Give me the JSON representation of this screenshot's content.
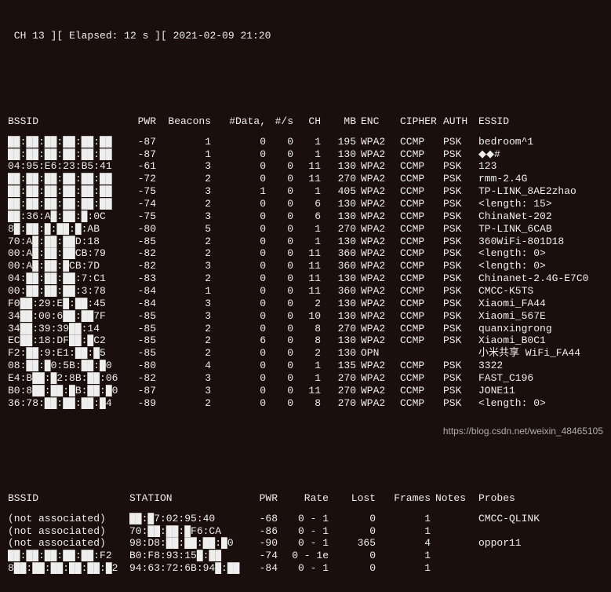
{
  "top_line": " CH 13 ][ Elapsed: 12 s ][ 2021-02-09 21:20",
  "ap_headers": {
    "bssid": "BSSID",
    "pwr": "PWR",
    "beacons": "Beacons",
    "data": "#Data,",
    "ps": "#/s",
    "ch": "CH",
    "mb": "MB",
    "enc": "ENC",
    "cipher": "CIPHER",
    "auth": "AUTH",
    "essid": "ESSID"
  },
  "aps": [
    {
      "bssid": "██:██:██:██:██:██",
      "pwr": "-87",
      "beacons": "1",
      "data": "0",
      "ps": "0",
      "ch": "1",
      "mb": "195",
      "enc": "WPA2",
      "cipher": "CCMP",
      "auth": "PSK",
      "essid": "bedroom^1"
    },
    {
      "bssid": "██:██:██:██:██:██",
      "pwr": "-87",
      "beacons": "1",
      "data": "0",
      "ps": "0",
      "ch": "1",
      "mb": "130",
      "enc": "WPA2",
      "cipher": "CCMP",
      "auth": "PSK",
      "essid": "◆◆#"
    },
    {
      "bssid": "04:95:E6:23:B5:41",
      "pwr": "-61",
      "beacons": "3",
      "data": "0",
      "ps": "0",
      "ch": "11",
      "mb": "130",
      "enc": "WPA2",
      "cipher": "CCMP",
      "auth": "PSK",
      "essid": "123"
    },
    {
      "bssid": "██:██:██:██:██:██",
      "pwr": "-72",
      "beacons": "2",
      "data": "0",
      "ps": "0",
      "ch": "11",
      "mb": "270",
      "enc": "WPA2",
      "cipher": "CCMP",
      "auth": "PSK",
      "essid": "rmm-2.4G"
    },
    {
      "bssid": "██:██:██:██:██:██",
      "pwr": "-75",
      "beacons": "3",
      "data": "1",
      "ps": "0",
      "ch": "1",
      "mb": "405",
      "enc": "WPA2",
      "cipher": "CCMP",
      "auth": "PSK",
      "essid": "TP-LINK_8AE2zhao"
    },
    {
      "bssid": "██:██:██:██:██:██",
      "pwr": "-74",
      "beacons": "2",
      "data": "0",
      "ps": "0",
      "ch": "6",
      "mb": "130",
      "enc": "WPA2",
      "cipher": "CCMP",
      "auth": "PSK",
      "essid": "<length: 15>"
    },
    {
      "bssid": "██:36:A█:██:█:0C",
      "pwr": "-75",
      "beacons": "3",
      "data": "0",
      "ps": "0",
      "ch": "6",
      "mb": "130",
      "enc": "WPA2",
      "cipher": "CCMP",
      "auth": "PSK",
      "essid": "ChinaNet-202"
    },
    {
      "bssid": "8█:██:█:██:█:AB",
      "pwr": "-80",
      "beacons": "5",
      "data": "0",
      "ps": "0",
      "ch": "1",
      "mb": "270",
      "enc": "WPA2",
      "cipher": "CCMP",
      "auth": "PSK",
      "essid": "TP-LINK_6CAB"
    },
    {
      "bssid": "70:A█:██:██D:18",
      "pwr": "-85",
      "beacons": "2",
      "data": "0",
      "ps": "0",
      "ch": "1",
      "mb": "130",
      "enc": "WPA2",
      "cipher": "CCMP",
      "auth": "PSK",
      "essid": "360WiFi-801D18"
    },
    {
      "bssid": "00:A█:██:██CB:79",
      "pwr": "-82",
      "beacons": "2",
      "data": "0",
      "ps": "0",
      "ch": "11",
      "mb": "360",
      "enc": "WPA2",
      "cipher": "CCMP",
      "auth": "PSK",
      "essid": "<length:  0>"
    },
    {
      "bssid": "00:A█:██:█CB:7D",
      "pwr": "-82",
      "beacons": "3",
      "data": "0",
      "ps": "0",
      "ch": "11",
      "mb": "360",
      "enc": "WPA2",
      "cipher": "CCMP",
      "auth": "PSK",
      "essid": "<length:  0>"
    },
    {
      "bssid": "04:██:██:██:7:C1",
      "pwr": "-83",
      "beacons": "2",
      "data": "0",
      "ps": "0",
      "ch": "11",
      "mb": "130",
      "enc": "WPA2",
      "cipher": "CCMP",
      "auth": "PSK",
      "essid": "Chinanet-2.4G-E7C0"
    },
    {
      "bssid": "00:██:██:██:3:78",
      "pwr": "-84",
      "beacons": "1",
      "data": "0",
      "ps": "0",
      "ch": "11",
      "mb": "360",
      "enc": "WPA2",
      "cipher": "CCMP",
      "auth": "PSK",
      "essid": "CMCC-K5TS"
    },
    {
      "bssid": "F0██:29:E█:██:45",
      "pwr": "-84",
      "beacons": "3",
      "data": "0",
      "ps": "0",
      "ch": "2",
      "mb": "130",
      "enc": "WPA2",
      "cipher": "CCMP",
      "auth": "PSK",
      "essid": "Xiaomi_FA44"
    },
    {
      "bssid": "34██:00:6██:██7F",
      "pwr": "-85",
      "beacons": "3",
      "data": "0",
      "ps": "0",
      "ch": "10",
      "mb": "130",
      "enc": "WPA2",
      "cipher": "CCMP",
      "auth": "PSK",
      "essid": "Xiaomi_567E"
    },
    {
      "bssid": "34██:39:39██:14",
      "pwr": "-85",
      "beacons": "2",
      "data": "0",
      "ps": "0",
      "ch": "8",
      "mb": "270",
      "enc": "WPA2",
      "cipher": "CCMP",
      "auth": "PSK",
      "essid": "quanxingrong"
    },
    {
      "bssid": "EC██:18:DF██:█C2",
      "pwr": "-85",
      "beacons": "2",
      "data": "6",
      "ps": "0",
      "ch": "8",
      "mb": "130",
      "enc": "WPA2",
      "cipher": "CCMP",
      "auth": "PSK",
      "essid": "Xiaomi_B0C1"
    },
    {
      "bssid": "F2:██:9:E1:██:█5",
      "pwr": "-85",
      "beacons": "2",
      "data": "0",
      "ps": "0",
      "ch": "2",
      "mb": "130",
      "enc": "OPN",
      "cipher": "",
      "auth": "",
      "essid": "      小米共享 WiFi_FA44"
    },
    {
      "bssid": "08:██:█0:5B:██:█0",
      "pwr": "-80",
      "beacons": "4",
      "data": "0",
      "ps": "0",
      "ch": "1",
      "mb": "135",
      "enc": "WPA2",
      "cipher": "CCMP",
      "auth": "PSK",
      "essid": "3322"
    },
    {
      "bssid": "E4:B██:█2:8B:██:06",
      "pwr": "-82",
      "beacons": "3",
      "data": "0",
      "ps": "0",
      "ch": "1",
      "mb": "270",
      "enc": "WPA2",
      "cipher": "CCMP",
      "auth": "PSK",
      "essid": "FAST_C196"
    },
    {
      "bssid": "B0:8██:██:█B:██:█0",
      "pwr": "-87",
      "beacons": "3",
      "data": "0",
      "ps": "0",
      "ch": "11",
      "mb": "270",
      "enc": "WPA2",
      "cipher": "CCMP",
      "auth": "PSK",
      "essid": "JONE11"
    },
    {
      "bssid": "36:78:██:██:██:█4",
      "pwr": "-89",
      "beacons": "2",
      "data": "0",
      "ps": "0",
      "ch": "8",
      "mb": "270",
      "enc": "WPA2",
      "cipher": "CCMP",
      "auth": "PSK",
      "essid": "<length:  0>"
    }
  ],
  "sta_headers": {
    "bssid": "BSSID",
    "station": "STATION",
    "pwr": "PWR",
    "rate": "Rate",
    "lost": "Lost",
    "frames": "Frames",
    "notes": "Notes",
    "probes": "Probes"
  },
  "stations": [
    {
      "bssid": "(not associated)",
      "station": "██:█7:02:95:40",
      "pwr": "-68",
      "rate": "0 - 1",
      "lost": "0",
      "frames": "1",
      "notes": "",
      "probes": "CMCC-QLINK"
    },
    {
      "bssid": "(not associated)",
      "station": "70:██:██:█F6:CA",
      "pwr": "-86",
      "rate": "0 - 1",
      "lost": "0",
      "frames": "1",
      "notes": "",
      "probes": ""
    },
    {
      "bssid": "(not associated)",
      "station": "98:D8:██:██:██:█0",
      "pwr": "-90",
      "rate": "0 - 1",
      "lost": "365",
      "frames": "4",
      "notes": "",
      "probes": "oppor11"
    },
    {
      "bssid": "██:██:██:██:██:F2",
      "station": "B0:F8:93:15█:██",
      "pwr": "-74",
      "rate": "0 - 1e",
      "lost": "0",
      "frames": "1",
      "notes": "",
      "probes": ""
    },
    {
      "bssid": "8██:██:██:██:██:█2",
      "station": "94:63:72:6B:94█:██",
      "pwr": "-84",
      "rate": "0 - 1",
      "lost": "0",
      "frames": "1",
      "notes": "",
      "probes": ""
    }
  ],
  "watermark": "https://blog.csdn.net/weixin_48465105"
}
